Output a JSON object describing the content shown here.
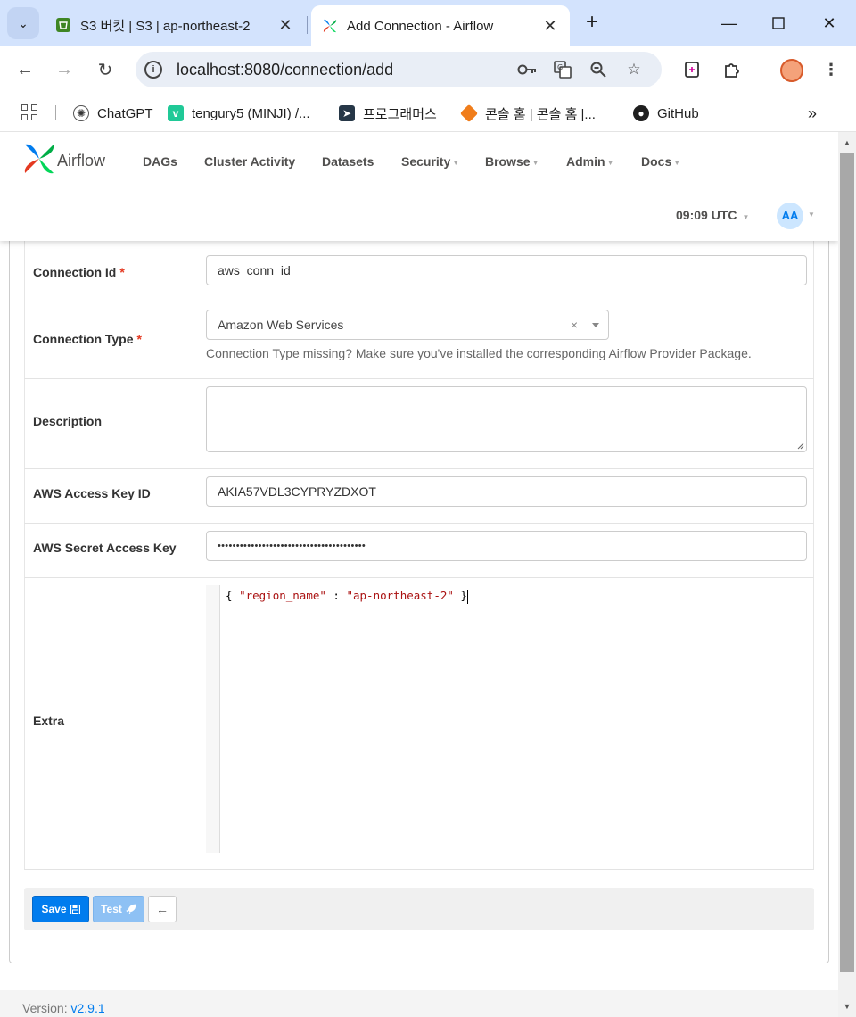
{
  "browser": {
    "tabs": [
      {
        "title": "S3 버킷 | S3 | ap-northeast-2",
        "active": false
      },
      {
        "title": "Add Connection - Airflow",
        "active": true
      }
    ],
    "url": "localhost:8080/connection/add",
    "bookmarks": [
      {
        "label": "ChatGPT",
        "icon": "chatgpt-icon"
      },
      {
        "label": "tengury5 (MINJI) /...",
        "icon": "velog-icon"
      },
      {
        "label": "프로그래머스",
        "icon": "programmers-icon"
      },
      {
        "label": "콘솔 홈 | 콘솔 홈 |...",
        "icon": "aws-console-icon"
      },
      {
        "label": "GitHub",
        "icon": "github-icon"
      }
    ],
    "more_bookmarks": "»"
  },
  "airflow": {
    "brand": "Airflow",
    "nav": [
      {
        "label": "DAGs",
        "dropdown": false
      },
      {
        "label": "Cluster Activity",
        "dropdown": false
      },
      {
        "label": "Datasets",
        "dropdown": false
      },
      {
        "label": "Security",
        "dropdown": true
      },
      {
        "label": "Browse",
        "dropdown": true
      },
      {
        "label": "Admin",
        "dropdown": true
      },
      {
        "label": "Docs",
        "dropdown": true
      }
    ],
    "time": "09:09 UTC",
    "user_initials": "AA"
  },
  "form": {
    "connection_id": {
      "label": "Connection Id",
      "required": "*",
      "value": "aws_conn_id"
    },
    "connection_type": {
      "label": "Connection Type",
      "required": "*",
      "value": "Amazon Web Services",
      "clear": "×",
      "help": "Connection Type missing? Make sure you've installed the corresponding Airflow Provider Package."
    },
    "description": {
      "label": "Description",
      "value": ""
    },
    "aws_access_key_id": {
      "label": "AWS Access Key ID",
      "value": "AKIA57VDL3CYPRYZDXOT"
    },
    "aws_secret_access_key": {
      "label": "AWS Secret Access Key",
      "value": "••••••••••••••••••••••••••••••••••••••••"
    },
    "extra": {
      "label": "Extra",
      "code_open": "{ ",
      "key": "\"region_name\"",
      "sep": " : ",
      "val": "\"ap-northeast-2\"",
      "code_close": " }"
    }
  },
  "actions": {
    "save_label": "Save",
    "test_label": "Test",
    "back_label": "←"
  },
  "footer": {
    "version_label": "Version:",
    "version": "v2.9.1"
  },
  "colors": {
    "accent": "#017cee",
    "required": "#e43921",
    "tab_bar": "#d3e3fd"
  }
}
